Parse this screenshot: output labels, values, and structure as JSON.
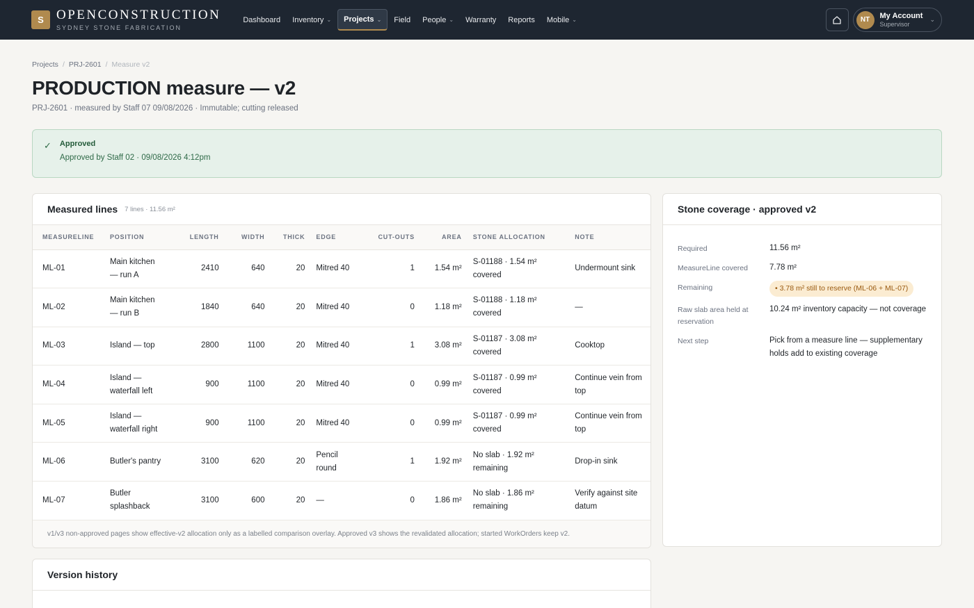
{
  "brand": {
    "mark": "S",
    "name": "OPENCONSTRUCTION",
    "sub": "SYDNEY STONE FABRICATION"
  },
  "nav": [
    {
      "label": "Dashboard",
      "chevron": false,
      "active": false
    },
    {
      "label": "Inventory",
      "chevron": true,
      "active": false
    },
    {
      "label": "Projects",
      "chevron": true,
      "active": true
    },
    {
      "label": "Field",
      "chevron": false,
      "active": false
    },
    {
      "label": "People",
      "chevron": true,
      "active": false
    },
    {
      "label": "Warranty",
      "chevron": false,
      "active": false
    },
    {
      "label": "Reports",
      "chevron": false,
      "active": false
    },
    {
      "label": "Mobile",
      "chevron": true,
      "active": false
    }
  ],
  "account": {
    "initials": "NT",
    "name": "My Account",
    "role": "Supervisor"
  },
  "breadcrumb": {
    "projects": "Projects",
    "project": "PRJ-2601",
    "current": "Measure v2"
  },
  "title": "PRODUCTION measure — v2",
  "subtitle": "PRJ-2601 · measured by Staff 07 09/08/2026 · Immutable; cutting released",
  "alert": {
    "title": "Approved",
    "body": "Approved by Staff 02 · 09/08/2026 4:12pm"
  },
  "lines": {
    "title": "Measured lines",
    "meta": "7 lines · 11.56 m²",
    "columns": [
      "MEASURELINE",
      "POSITION",
      "LENGTH",
      "WIDTH",
      "THICK",
      "EDGE",
      "CUT-OUTS",
      "AREA",
      "STONE ALLOCATION",
      "NOTE"
    ],
    "rows": [
      {
        "id": "ML-01",
        "position": "Main kitchen — run A",
        "length": "2410",
        "width": "640",
        "thick": "20",
        "edge": "Mitred 40",
        "cutouts": "1",
        "area": "1.54 m²",
        "allocation": "S-01188 · 1.54 m² covered",
        "note": "Undermount sink"
      },
      {
        "id": "ML-02",
        "position": "Main kitchen — run B",
        "length": "1840",
        "width": "640",
        "thick": "20",
        "edge": "Mitred 40",
        "cutouts": "0",
        "area": "1.18 m²",
        "allocation": "S-01188 · 1.18 m² covered",
        "note": "—"
      },
      {
        "id": "ML-03",
        "position": "Island — top",
        "length": "2800",
        "width": "1100",
        "thick": "20",
        "edge": "Mitred 40",
        "cutouts": "1",
        "area": "3.08 m²",
        "allocation": "S-01187 · 3.08 m² covered",
        "note": "Cooktop"
      },
      {
        "id": "ML-04",
        "position": "Island — waterfall left",
        "length": "900",
        "width": "1100",
        "thick": "20",
        "edge": "Mitred 40",
        "cutouts": "0",
        "area": "0.99 m²",
        "allocation": "S-01187 · 0.99 m² covered",
        "note": "Continue vein from top"
      },
      {
        "id": "ML-05",
        "position": "Island — waterfall right",
        "length": "900",
        "width": "1100",
        "thick": "20",
        "edge": "Mitred 40",
        "cutouts": "0",
        "area": "0.99 m²",
        "allocation": "S-01187 · 0.99 m² covered",
        "note": "Continue vein from top"
      },
      {
        "id": "ML-06",
        "position": "Butler's pantry",
        "length": "3100",
        "width": "620",
        "thick": "20",
        "edge": "Pencil round",
        "cutouts": "1",
        "area": "1.92 m²",
        "allocation": "No slab · 1.92 m² remaining",
        "note": "Drop-in sink"
      },
      {
        "id": "ML-07",
        "position": "Butler splashback",
        "length": "3100",
        "width": "600",
        "thick": "20",
        "edge": "—",
        "cutouts": "0",
        "area": "1.86 m²",
        "allocation": "No slab · 1.86 m² remaining",
        "note": "Verify against site datum"
      }
    ],
    "footnote": "v1/v3 non-approved pages show effective-v2 allocation only as a labelled comparison overlay. Approved v3 shows the revalidated allocation; started WorkOrders keep v2."
  },
  "coverage": {
    "title": "Stone coverage · approved v2",
    "required_label": "Required",
    "required": "11.56 m²",
    "covered_label": "MeasureLine covered",
    "covered": "7.78 m²",
    "remaining_label": "Remaining",
    "remaining": "• 3.78 m² still to reserve (ML-06 + ML-07)",
    "raw_label": "Raw slab area held at reservation",
    "raw": "10.24 m² inventory capacity — not coverage",
    "next_label": "Next step",
    "next": "Pick from a measure line — supplementary holds add to existing coverage"
  },
  "history": {
    "title": "Version history"
  },
  "colors": {
    "accent": "#b08a4e",
    "nav_bg": "#1e2631",
    "success_bg": "#e6f1ea",
    "warning_pill": "#fbecd2"
  }
}
